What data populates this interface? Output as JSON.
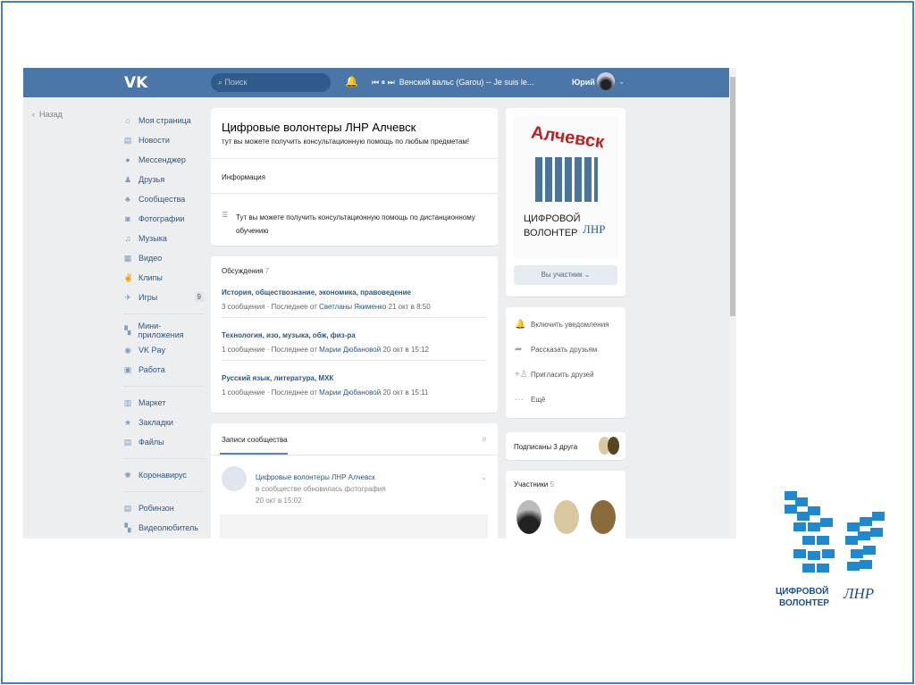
{
  "topbar": {
    "search_placeholder": "Поиск",
    "track": "Венский вальс (Garou) -- Je suis le...",
    "user": "Юрий"
  },
  "sidebar": {
    "back": "Назад",
    "items": [
      {
        "label": "Моя страница",
        "icon": "⌂"
      },
      {
        "label": "Новости",
        "icon": "▤"
      },
      {
        "label": "Мессенджер",
        "icon": "●"
      },
      {
        "label": "Друзья",
        "icon": "♟"
      },
      {
        "label": "Сообщества",
        "icon": "♣"
      },
      {
        "label": "Фотографии",
        "icon": "◙"
      },
      {
        "label": "Музыка",
        "icon": "♫"
      },
      {
        "label": "Видео",
        "icon": "▦"
      },
      {
        "label": "Клипы",
        "icon": "✌"
      },
      {
        "label": "Игры",
        "icon": "✈",
        "badge": "9"
      }
    ],
    "items2": [
      {
        "label": "Мини-приложения",
        "icon": "▚"
      },
      {
        "label": "VK Pay",
        "icon": "◉"
      },
      {
        "label": "Работа",
        "icon": "▣"
      }
    ],
    "items3": [
      {
        "label": "Маркет",
        "icon": "▥"
      },
      {
        "label": "Закладки",
        "icon": "★"
      },
      {
        "label": "Файлы",
        "icon": "▤"
      }
    ],
    "items4": [
      {
        "label": "Коронавирус",
        "icon": "✺"
      }
    ],
    "items5": [
      {
        "label": "Робинзон",
        "icon": "▤"
      },
      {
        "label": "Видеолюбитель",
        "icon": "▚"
      }
    ]
  },
  "group": {
    "name": "Цифровые волонтеры ЛНР Алчевск",
    "status": "тут вы можете получить консультационную помощь по любым предметам!",
    "info_label": "Информация",
    "info_text": "Тут вы можете получить консультационную помощь по дистанционному обучению"
  },
  "discussions": {
    "label": "Обсуждения",
    "count": "7",
    "items": [
      {
        "title": "История, обществознание, экономика, правоведение",
        "count": "3 сообщения",
        "last": "Последнее от",
        "author": "Светланы Якименко",
        "date": "21 окт в 8:50"
      },
      {
        "title": "Технология, изо, музыка, обж, физ-ра",
        "count": "1 сообщение",
        "last": "Последнее от",
        "author": "Марии Дюбановой",
        "date": "20 окт в 15:12"
      },
      {
        "title": "Русский язык, литература, МХК",
        "count": "1 сообщение",
        "last": "Последнее от",
        "author": "Марии Дюбановой",
        "date": "20 окт в 15:11"
      }
    ]
  },
  "posts": {
    "tab": "Записи сообщества",
    "author": "Цифровые волонтеры ЛНР Алчевск",
    "action": "в сообществе обновилась фотография",
    "date": "20 окт в 15:02"
  },
  "cover": {
    "city": "Алчевск",
    "line1": "ЦИФРОВОЙ",
    "line2": "ВОЛОНТЕР",
    "lnr": "ЛНР"
  },
  "member_button": "Вы участник ⌄",
  "actions": [
    {
      "icon": "🔔",
      "label": "Включить уведомления"
    },
    {
      "icon": "➦",
      "label": "Рассказать друзьям"
    },
    {
      "icon": "+♙",
      "label": "Пригласить друзей"
    },
    {
      "icon": "···",
      "label": "Ещё"
    }
  ],
  "friends": "Подписаны 3 друга",
  "members": {
    "label": "Участники",
    "count": "5"
  },
  "colors": {
    "header": "#4a76a8",
    "link": "#2a5885",
    "logo": "#1e88d0"
  }
}
